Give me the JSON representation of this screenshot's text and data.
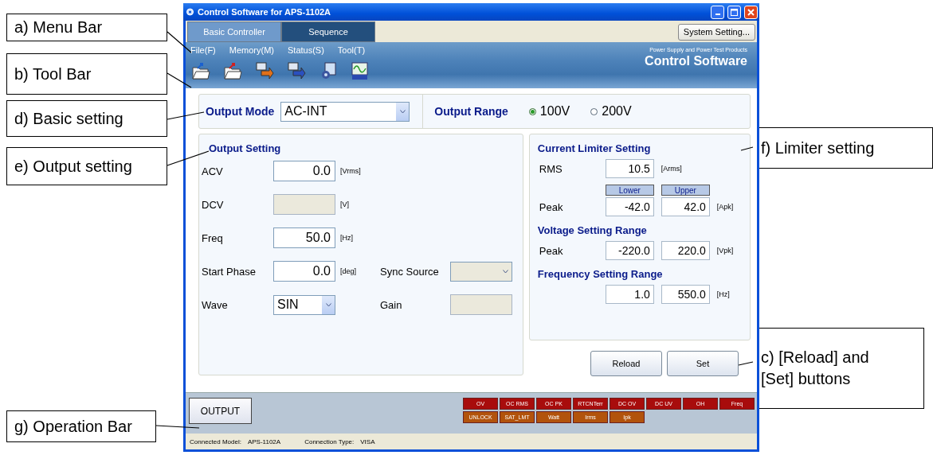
{
  "callouts": [
    {
      "text": "a) Menu Bar"
    },
    {
      "text": "b) Tool Bar"
    },
    {
      "text": "d) Basic setting"
    },
    {
      "text": "e) Output setting"
    },
    {
      "text": "g) Operation Bar"
    },
    {
      "text": "f) Limiter setting"
    },
    {
      "text": "c) [Reload] and [Set] buttons"
    }
  ],
  "window": {
    "title": "Control Software for APS-1102A"
  },
  "tabs": [
    {
      "label": "Basic Controller",
      "selected": true
    },
    {
      "label": "Sequence",
      "selected": false
    }
  ],
  "system_button": "System Setting...",
  "menu": [
    "File(F)",
    "Memory(M)",
    "Status(S)",
    "Tool(T)"
  ],
  "branding": {
    "tagline": "Power Supply and Power Test Products",
    "product": "Control Software"
  },
  "basic_setting": {
    "output_mode": {
      "label": "Output Mode",
      "value": "AC-INT"
    },
    "output_range": {
      "label": "Output Range",
      "options": [
        {
          "label": "100V",
          "selected": true
        },
        {
          "label": "200V",
          "selected": false
        }
      ]
    }
  },
  "output_setting": {
    "title": "Output Setting",
    "rows": [
      {
        "fields": [
          {
            "label": "ACV",
            "kind": "input",
            "value": "0.0",
            "unit": "[Vrms]",
            "disabled": false
          }
        ]
      },
      {
        "fields": [
          {
            "label": "DCV",
            "kind": "input",
            "unit": "[V]",
            "disabled": true
          }
        ]
      },
      {
        "fields": [
          {
            "label": "Freq",
            "kind": "input",
            "value": "50.0",
            "unit": "[Hz]",
            "disabled": false
          }
        ]
      },
      {
        "fields": [
          {
            "label": "Start Phase",
            "kind": "input",
            "value": "0.0",
            "unit": "[deg]",
            "disabled": false
          },
          {
            "label": "Sync Source",
            "kind": "select",
            "disabled": true
          }
        ]
      },
      {
        "fields": [
          {
            "label": "Wave",
            "kind": "select",
            "value": "SIN",
            "disabled": false
          },
          {
            "label": "Gain",
            "kind": "input",
            "disabled": true
          }
        ]
      }
    ]
  },
  "limiter_setting": {
    "sections": [
      {
        "title": "Current Limiter Setting",
        "rows": [
          {
            "kind": "fields",
            "label": "RMS",
            "values": [
              "10.5"
            ],
            "unit": "[Arms]"
          },
          {
            "kind": "header",
            "values": [
              "Lower",
              "Upper"
            ]
          },
          {
            "kind": "fields",
            "label": "Peak",
            "values": [
              "-42.0",
              "42.0"
            ],
            "unit": "[Apk]"
          }
        ]
      },
      {
        "title": "Voltage Setting Range",
        "rows": [
          {
            "kind": "fields",
            "label": "Peak",
            "values": [
              "-220.0",
              "220.0"
            ],
            "unit": "[Vpk]"
          }
        ]
      },
      {
        "title": "Frequency Setting Range",
        "rows": [
          {
            "kind": "fields",
            "values": [
              "1.0",
              "550.0"
            ],
            "unit": "[Hz]"
          }
        ]
      }
    ]
  },
  "buttons": [
    "Reload",
    "Set"
  ],
  "operation_bar": {
    "output_button": "OUTPUT",
    "indicators": [
      {
        "label": "OV",
        "color": "#a80c0c"
      },
      {
        "label": "OC RMS",
        "color": "#a80c0c"
      },
      {
        "label": "OC PK",
        "color": "#a80c0c"
      },
      {
        "label": "RTCNTerr",
        "color": "#a80c0c"
      },
      {
        "label": "DC OV",
        "color": "#a80c0c"
      },
      {
        "label": "DC UV",
        "color": "#a80c0c"
      },
      {
        "label": "OH",
        "color": "#a80c0c"
      },
      {
        "label": "Freq",
        "color": "#a80c0c"
      },
      {
        "label": "UNLOCK",
        "color": "#b2530c"
      },
      {
        "label": "SAT_LMT",
        "color": "#b2530c"
      },
      {
        "label": "Watt",
        "color": "#b2530c"
      },
      {
        "label": "Irms",
        "color": "#b2530c"
      },
      {
        "label": "Ipk",
        "color": "#b2530c"
      }
    ]
  },
  "status_bar": [
    {
      "label": "Connected Model:",
      "value": "APS-1102A"
    },
    {
      "label": "Connection Type:",
      "value": "VISA"
    }
  ]
}
